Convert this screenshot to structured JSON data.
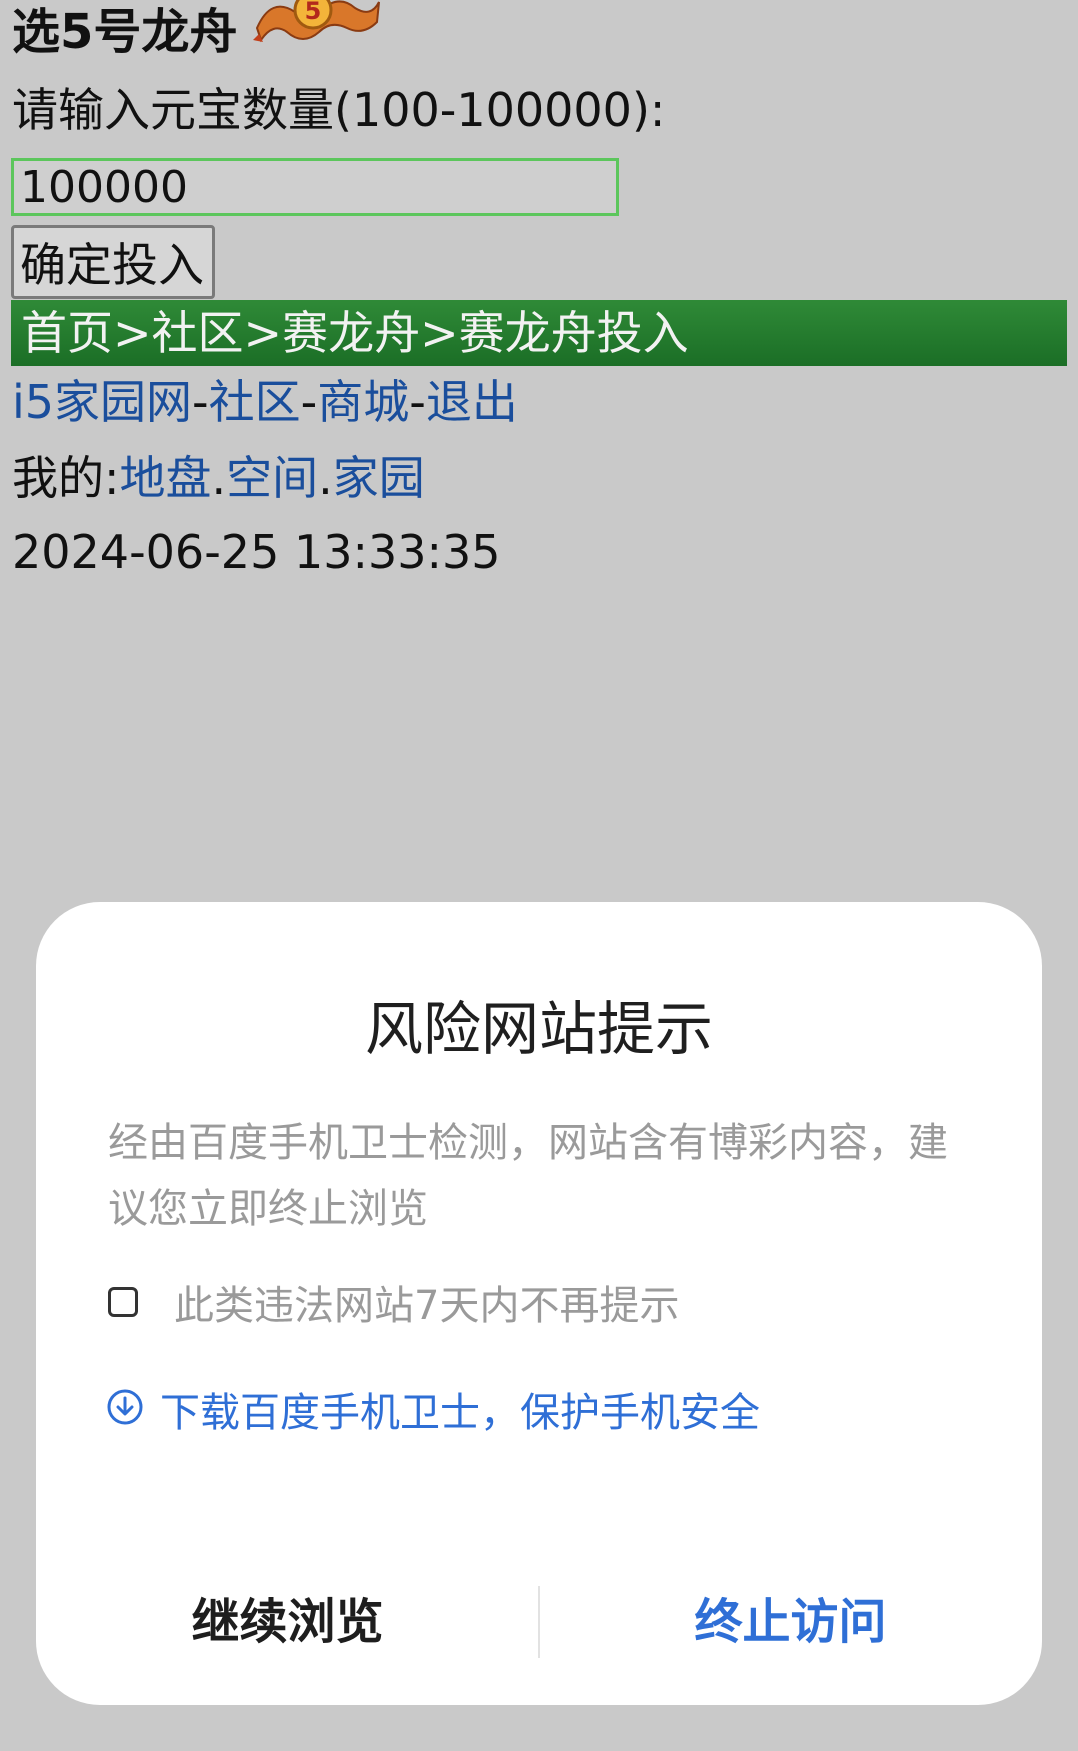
{
  "page": {
    "title": "选5号龙舟",
    "prompt": "请输入元宝数量(100-100000):",
    "amount_value": "100000",
    "confirm_label": "确定投入",
    "breadcrumb": "首页>社区>赛龙舟>赛龙舟投入",
    "links": [
      "i5家园网",
      "社区",
      "商城",
      "退出"
    ],
    "link_separator": "-",
    "mine_prefix": "我的:",
    "mine_links": [
      "地盘",
      "空间",
      "家园"
    ],
    "mine_separator": ".",
    "timestamp": "2024-06-25 13:33:35",
    "badge_number": "5"
  },
  "dialog": {
    "title": "风险网站提示",
    "message": "经由百度手机卫士检测，网站含有博彩内容，建议您立即终止浏览",
    "checkbox_label": "此类违法网站7天内不再提示",
    "download_label": "下载百度手机卫士，保护手机安全",
    "continue_label": "继续浏览",
    "stop_label": "终止访问"
  },
  "colors": {
    "background": "#c9c9c9",
    "breadcrumb_bg": "#1f7a2c",
    "link": "#1a4e9c",
    "accent_blue": "#2f6fd6",
    "input_border": "#5cc65c"
  },
  "icons": {
    "dragon_badge": "dragon-badge-icon",
    "download": "download-circle-icon"
  }
}
